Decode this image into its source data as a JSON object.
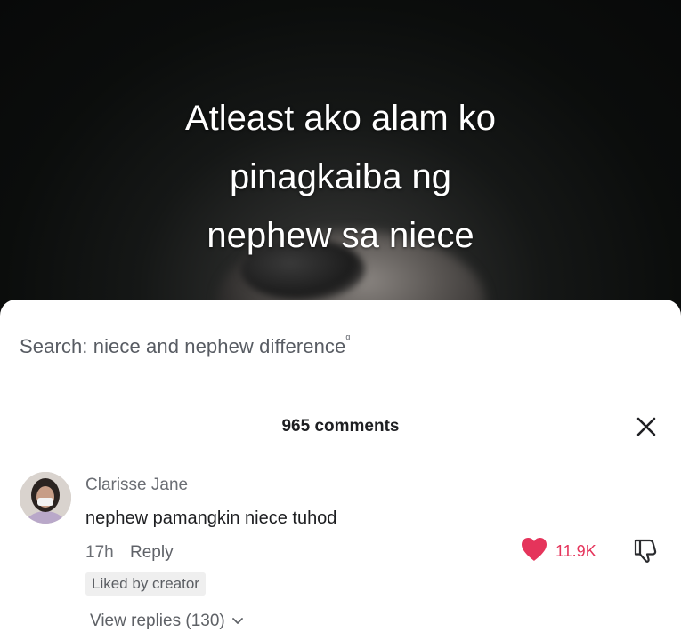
{
  "video": {
    "caption": "Atleast ako alam ko\npinagkaiba ng\nnephew sa niece"
  },
  "search": {
    "prefix": "Search: ",
    "query": "niece and nephew difference",
    "icon": "search-icon"
  },
  "comments_panel": {
    "count_label": "965 comments",
    "close_icon": "close-icon"
  },
  "comment": {
    "author": "Clarisse Jane",
    "text": "nephew pamangkin niece tuhod",
    "time": "17h",
    "reply_label": "Reply",
    "liked_by_creator": "Liked by creator",
    "like_count": "11.9K",
    "like_color": "#e5345b",
    "view_replies": "View replies (130)",
    "icons": [
      "heart-icon",
      "dislike-icon",
      "chevron-down-icon"
    ]
  }
}
